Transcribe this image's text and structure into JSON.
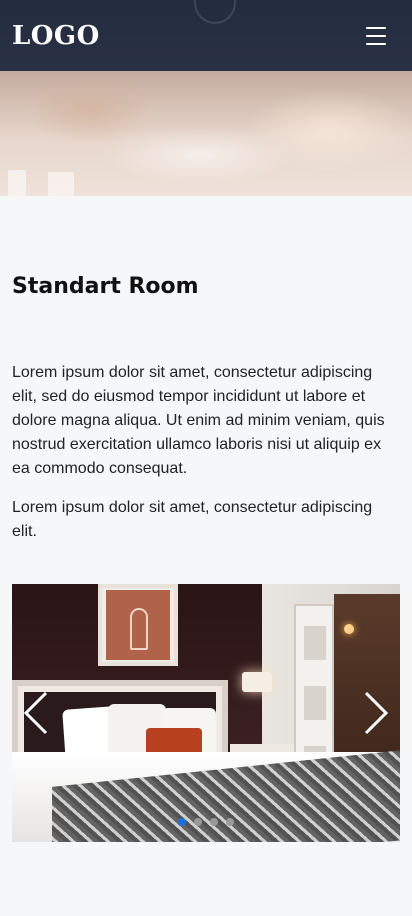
{
  "header": {
    "logo_text": "LOGO",
    "menu_icon": "hamburger-icon"
  },
  "room": {
    "title": "Standart Room",
    "paragraphs": [
      "Lorem ipsum dolor sit amet, consectetur adipiscing elit, sed do eiusmod tempor incididunt ut labore et dolore magna aliqua. Ut enim ad minim veniam, quis nostrud exercitation ullamco laboris nisi ut aliquip ex ea commodo consequat.",
      "Lorem ipsum dolor sit amet, consectetur adipiscing elit."
    ]
  },
  "carousel": {
    "prev_icon": "chevron-left-icon",
    "next_icon": "chevron-right-icon",
    "slide_count": 4,
    "active_index": 0,
    "active_color": "#1e6fe0"
  }
}
